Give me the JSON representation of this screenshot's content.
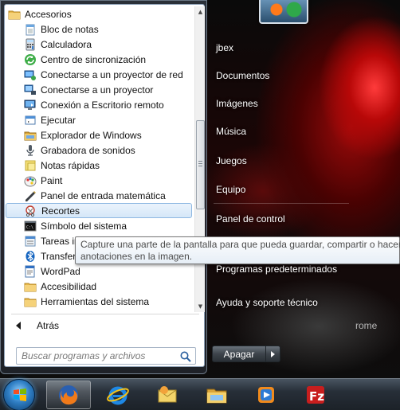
{
  "start_menu": {
    "programs": [
      {
        "label": "Accesorios",
        "icon": "folder-icon",
        "kind": "folder-root"
      },
      {
        "label": "Bloc de notas",
        "icon": "notepad-icon",
        "kind": "child"
      },
      {
        "label": "Calculadora",
        "icon": "calculator-icon",
        "kind": "child"
      },
      {
        "label": "Centro de sincronización",
        "icon": "sync-center-icon",
        "kind": "child"
      },
      {
        "label": "Conectarse a un proyector de red",
        "icon": "network-projector-icon",
        "kind": "child"
      },
      {
        "label": "Conectarse a un proyector",
        "icon": "projector-icon",
        "kind": "child"
      },
      {
        "label": "Conexión a Escritorio remoto",
        "icon": "remote-desktop-icon",
        "kind": "child"
      },
      {
        "label": "Ejecutar",
        "icon": "run-icon",
        "kind": "child"
      },
      {
        "label": "Explorador de Windows",
        "icon": "explorer-icon",
        "kind": "child"
      },
      {
        "label": "Grabadora de sonidos",
        "icon": "microphone-icon",
        "kind": "child"
      },
      {
        "label": "Notas rápidas",
        "icon": "sticky-notes-icon",
        "kind": "child"
      },
      {
        "label": "Paint",
        "icon": "paint-icon",
        "kind": "child"
      },
      {
        "label": "Panel de entrada matemática",
        "icon": "math-input-icon",
        "kind": "child"
      },
      {
        "label": "Recortes",
        "icon": "snipping-tool-icon",
        "kind": "child",
        "selected": true
      },
      {
        "label": "Símbolo del sistema",
        "icon": "command-prompt-icon",
        "kind": "child"
      },
      {
        "label": "Tareas in",
        "icon": "tasks-icon",
        "kind": "child"
      },
      {
        "label": "Transfer",
        "icon": "bluetooth-icon",
        "kind": "child"
      },
      {
        "label": "WordPad",
        "icon": "wordpad-icon",
        "kind": "child"
      },
      {
        "label": "Accesibilidad",
        "icon": "folder-icon",
        "kind": "child"
      },
      {
        "label": "Herramientas del sistema",
        "icon": "folder-icon",
        "kind": "child"
      }
    ],
    "back_label": "Atrás",
    "search_placeholder": "Buscar programas y archivos",
    "right_items": [
      {
        "label": "jbex",
        "name": "user-name"
      },
      {
        "label": "Documentos",
        "name": "documents-link"
      },
      {
        "label": "Imágenes",
        "name": "pictures-link"
      },
      {
        "label": "Música",
        "name": "music-link"
      },
      {
        "label": "Juegos",
        "name": "games-link"
      },
      {
        "label": "Equipo",
        "name": "computer-link"
      },
      {
        "label": "Panel de control",
        "name": "control-panel-link"
      },
      {
        "label": "Programas predeterminados",
        "name": "default-programs-link"
      },
      {
        "label": "Ayuda y soporte técnico",
        "name": "help-support-link"
      }
    ],
    "shutdown_label": "Apagar"
  },
  "tooltip": {
    "line1": "Capture una parte de la pantalla para que pueda guardar, compartir o hacer",
    "line2": "anotaciones en la imagen."
  },
  "wallpaper": {
    "visible_text": "rome"
  },
  "taskbar": {
    "items": [
      {
        "icon": "windows-start-icon"
      },
      {
        "icon": "firefox-icon",
        "active": true
      },
      {
        "icon": "internet-explorer-icon"
      },
      {
        "icon": "outlook-icon"
      },
      {
        "icon": "windows-explorer-icon"
      },
      {
        "icon": "media-player-icon"
      },
      {
        "icon": "filezilla-icon"
      }
    ]
  },
  "colors": {
    "selection_border": "#8fb8e2",
    "folder_yellow": "#e8b84a",
    "taskbar": "#1c2228"
  }
}
